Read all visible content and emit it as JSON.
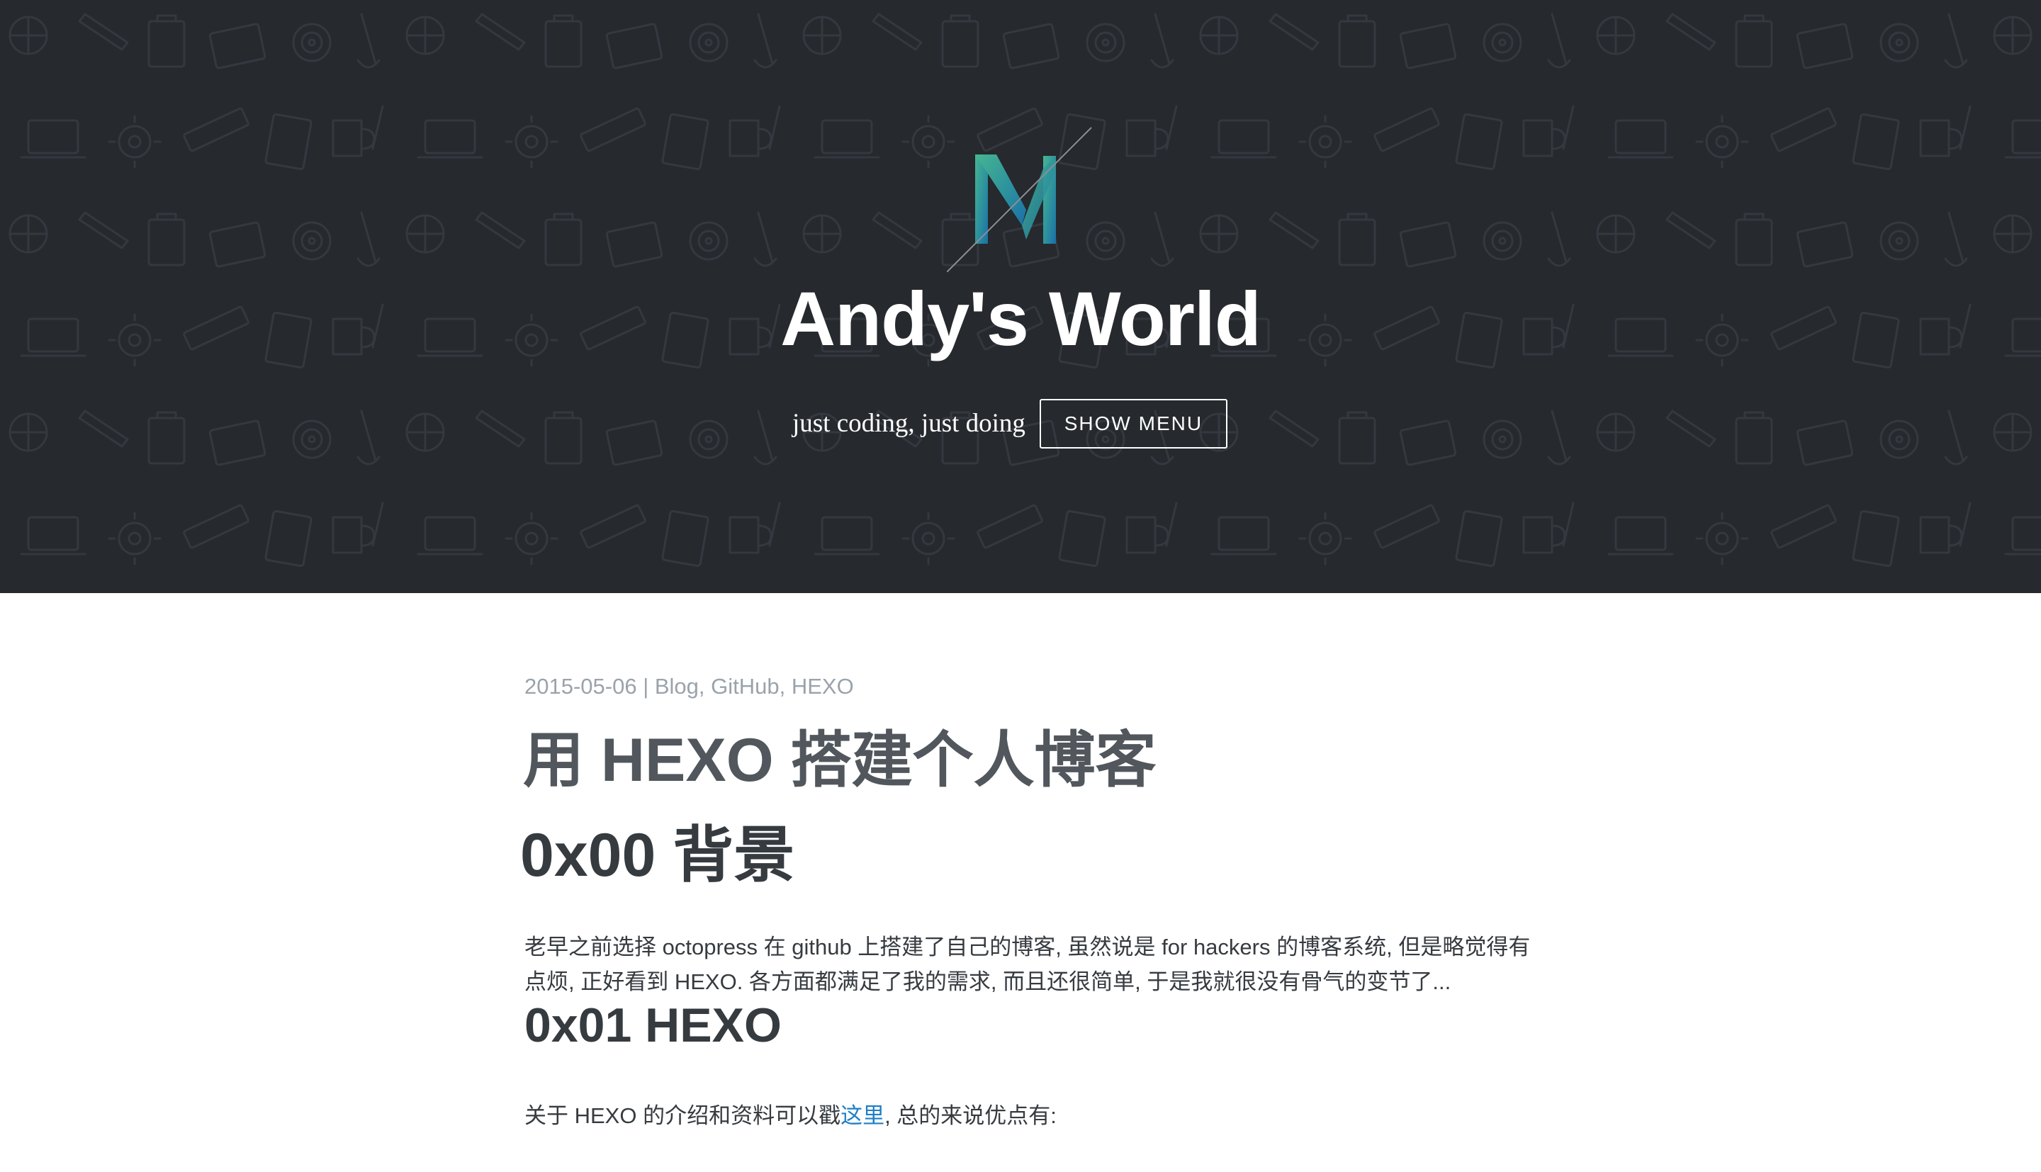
{
  "header": {
    "logo_icon": "m-logo-icon",
    "title": "Andy's World",
    "tagline": "just coding, just doing",
    "menu_button_label": "SHOW MENU",
    "background_color": "#26292d"
  },
  "post": {
    "date": "2015-05-06",
    "separator": " | ",
    "categories": [
      "Blog",
      "GitHub",
      "HEXO"
    ],
    "title": "用 HEXO 搭建个人博客",
    "sections": [
      {
        "heading": "0x00 背景",
        "paragraph": "老早之前选择 octopress 在 github 上搭建了自己的博客, 虽然说是 for hackers 的博客系统, 但是略觉得有点烦, 正好看到 HEXO. 各方面都满足了我的需求, 而且还很简单, 于是我就很没有骨气的变节了..."
      },
      {
        "heading": "0x01 HEXO",
        "paragraph_prefix": "关于 HEXO 的介绍和资料可以戳",
        "paragraph_link": "这里",
        "paragraph_suffix": ", 总的来说优点有:"
      }
    ]
  },
  "colors": {
    "link": "#1e7fc6",
    "meta": "#9aa3ab",
    "text": "#363b40",
    "logo_gradient_start": "#3fae8c",
    "logo_gradient_end": "#1f7fa8"
  }
}
